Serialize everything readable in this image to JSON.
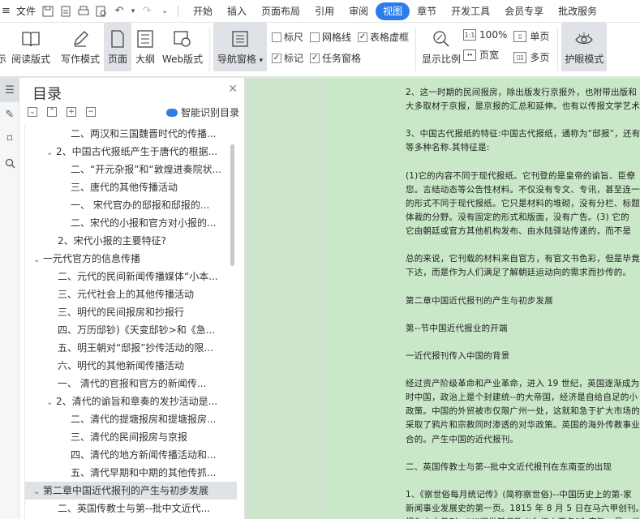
{
  "menubar": {
    "file_label": "文件",
    "tabs": [
      "开始",
      "插入",
      "页面布局",
      "引用",
      "审阅",
      "视图",
      "章节",
      "开发工具",
      "会员专享",
      "批改服务"
    ],
    "active_tab": "视图"
  },
  "ribbon": {
    "partial_label": "示",
    "reading_mode": "阅读版式",
    "writing_mode": "写作模式",
    "page": "页面",
    "outline": "大纲",
    "web_layout": "Web版式",
    "nav_pane": "导航窗格",
    "ruler": "标尺",
    "gridlines": "网格线",
    "table_gridlines": "表格虚框",
    "marks": "标记",
    "task_pane": "任务窗格",
    "display_ratio": "显示比例",
    "zoom_100": "100%",
    "page_width": "页宽",
    "single_page": "单页",
    "multi_page": "多页",
    "eye_mode": "护眼模式"
  },
  "toc": {
    "title": "目录",
    "smart_label": "智能识别目录",
    "items": [
      "二、两汉和三国魏晋时代的传播...",
      "2、中国古代报纸产生于唐代的根据...",
      "二、“开元杂报”和“敦煌进奏院状...",
      "三、唐代的其他传播活动",
      "一、 宋代官办的邸报和邸报的...",
      "二、宋代的小报和官方对小报的...",
      "2、宋代小报的主要特征?",
      "一元代官方的信息传播",
      "二、元代的民间新闻传播媒体“小本...",
      "三、元代社会上的其他传播活动",
      "三、明代的民间报房和抄报行",
      "四、万历邸钞)《天变邸钞>和《急...",
      "五、明王朝对“邸报”抄传活动的限...",
      "六、明代的其他新闻传播活动",
      "一、 清代的官报和官方的新闻传...",
      "2、清代的谕旨和章奏的发抄活动是...",
      "二、清代的提塘报房和提塘报房...",
      "三、清代的民间报房与京报",
      "四、清代的地方新闻传播活动和...",
      "五、清代早期和中期的其他传抓...",
      "第二章中国近代报刊的产生与初步发展",
      "二、英国传教士与第--批中文近代..."
    ]
  },
  "doc": {
    "lines": [
      "2、这一时期的民间报房，除出版发行京报外，也附带出版和",
      "大多取材于京报，是京报的汇总和延伸。也有以传报文学艺术",
      "",
      "3、中国古代报纸的特征:中国古代报纸，通称为“邸报”，还有",
      "等多种名称.其特征是:",
      "",
      "(1)它的内容不同于现代报纸。它刊登的是皇帝的谕旨、臣僚",
      "您。言结动态等公告性材料。不仅没有专文、专讯，甚至连一",
      "的形式不同于现代报纸。它只是材料的堆砌，没有分栏、标题",
      "体裁的分野。没有固定的形式和版面，没有广告。(3) 它的",
      "它由朝廷或官方其他机构发布、由水陆驿站传递的，而不是",
      "",
      "总的来说，它刊载的材料来自官方，有官文书色彩，但是毕竟",
      "下达，而是作为人们满足了解朝廷运动向的需求而抄传的。",
      "",
      "第二章中国近代报刊的产生与初步发展",
      "",
      "第--节中国近代报业的开端",
      "",
      "一近代报刊传入中国的背景",
      "",
      "经过资产阶级革命和产业革命，进入 19 世纪，英国逐渐成为",
      "时中国，政治上是个封建统--的大帝国，经济是自给自足的小",
      "政策。中国的外贸被市仅限广州一处，这就和急于扩大市场的",
      "采取了鸦片和宗教同时渗透的对华政策。英国的海外传教事业",
      "合的。产生中国的近代报刊。",
      "",
      "二、英国传教士与第--批中文近代报刊在东南亚的出现",
      "",
      "1、《察世俗每月统记传》(简称察世俗)--中国历史上的第-家",
      "新闻事业发展史的第一页。1815 年 8 月 5 日在马六甲创刊。",
      "报为中文月刊，以“阐发基督教义为根本要务”为宗旨，是一份"
    ]
  }
}
